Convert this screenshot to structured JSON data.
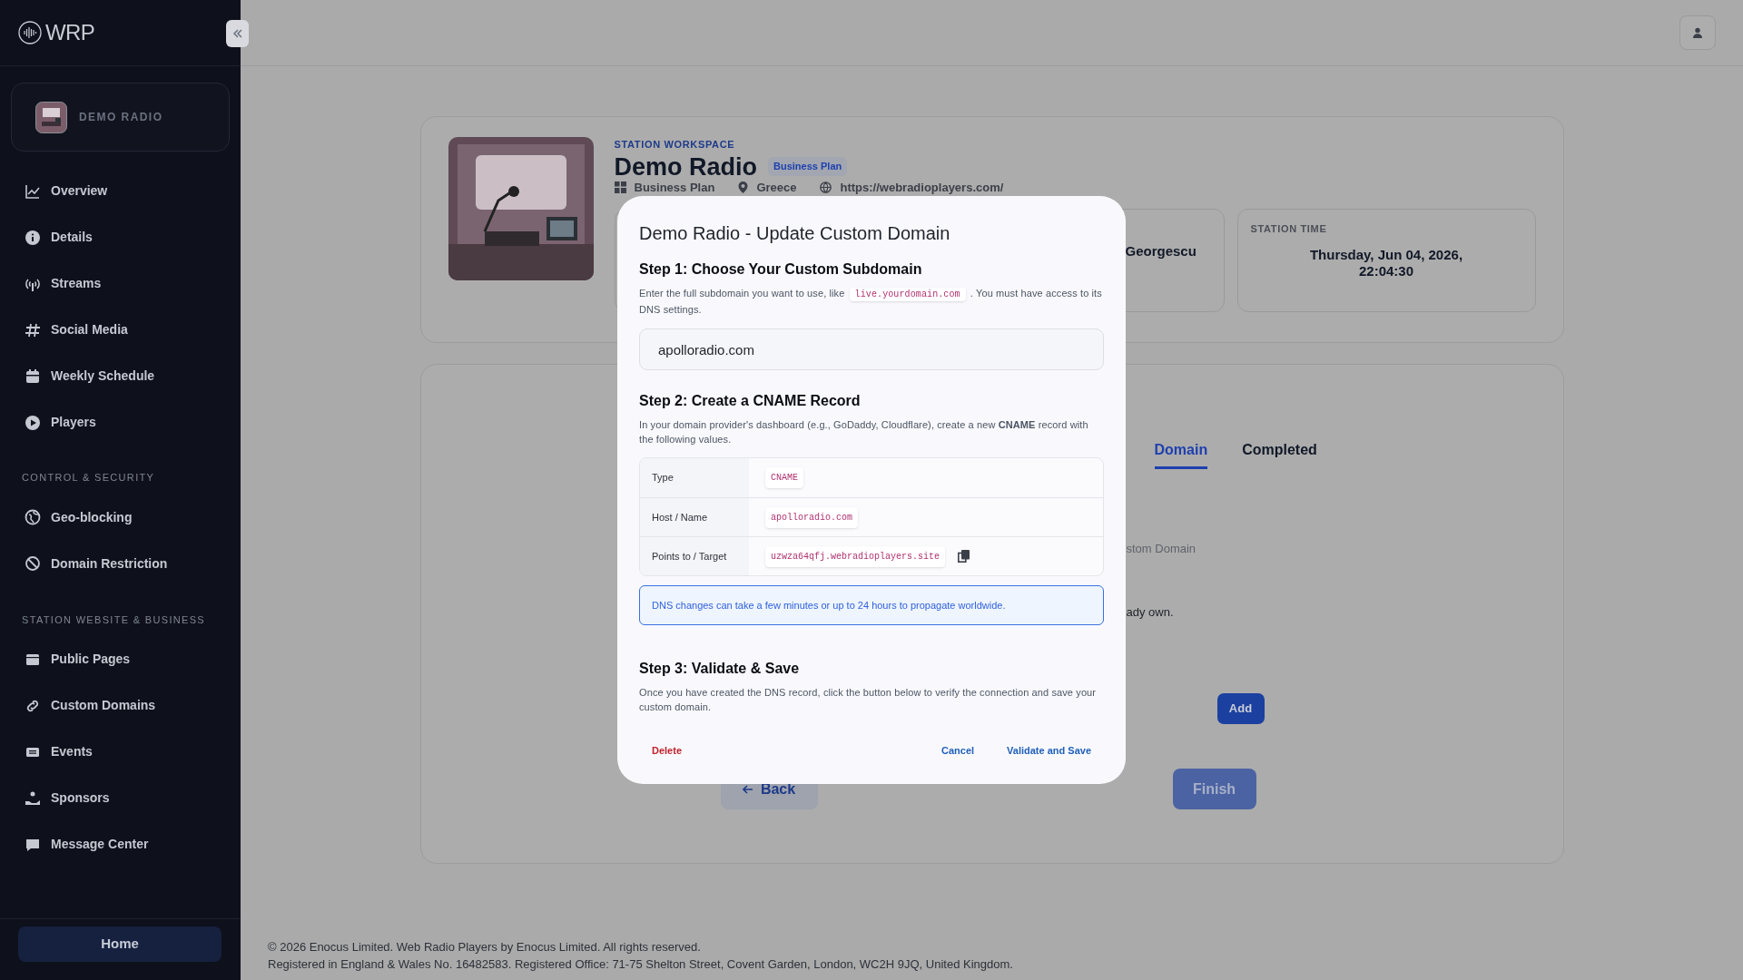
{
  "sidebar": {
    "logo": "WRP",
    "station": "DEMO RADIO",
    "sections": [
      {
        "items": [
          "Overview",
          "Details",
          "Streams",
          "Social Media",
          "Weekly Schedule",
          "Players"
        ]
      },
      {
        "heading": "CONTROL & SECURITY",
        "items": [
          "Geo-blocking",
          "Domain Restriction"
        ]
      },
      {
        "heading": "STATION WEBSITE & BUSINESS",
        "items": [
          "Public Pages",
          "Custom Domains",
          "Events",
          "Sponsors",
          "Message Center"
        ]
      }
    ],
    "home_button": "Home"
  },
  "station": {
    "eyebrow": "STATION WORKSPACE",
    "name": "Demo Radio",
    "badge": "Business Plan",
    "meta": [
      "Business Plan",
      "Greece",
      "https://webradioplayers.com/"
    ],
    "info_cards": [
      {
        "value": "Georgescu"
      },
      {
        "label": "STATION TIME",
        "value": "Thursday, Jun 04, 2026, 22:04:30"
      }
    ]
  },
  "wizard": {
    "tabs": [
      {
        "label": "Domain",
        "selected": true
      },
      {
        "label": "Completed",
        "selected": false
      }
    ],
    "fragment_1": "stom Domain",
    "fragment_2": "ady own.",
    "add_button": "Add",
    "back_button": "Back",
    "finish_button": "Finish"
  },
  "modal": {
    "title": "Demo Radio - Update Custom Domain",
    "step_1": {
      "heading": "Step 1: Choose Your Custom Subdomain",
      "text_before": "Enter the full subdomain you want to use, like",
      "code": "live.yourdomain.com",
      "text_after": ". You must have access to its DNS settings.",
      "input_value": "apolloradio.com"
    },
    "step_2": {
      "heading": "Step 2: Create a CNAME Record",
      "text": "In your domain provider's dashboard (e.g., GoDaddy, Cloudflare), create a new **CNAME** record with the following values.",
      "rows": [
        {
          "label": "Type",
          "value": "CNAME",
          "copy": false
        },
        {
          "label": "Host / Name",
          "value": "apolloradio.com",
          "copy": false
        },
        {
          "label": "Points to / Target",
          "value": "uzwza64qfj.webradioplayers.site",
          "copy": true
        }
      ],
      "notice": "DNS changes can take a few minutes or up to 24 hours to propagate worldwide."
    },
    "step_3": {
      "heading": "Step 3: Validate & Save",
      "text": "Once you have created the DNS record, click the button below to verify the connection and save your custom domain."
    },
    "buttons": {
      "delete": "Delete",
      "cancel": "Cancel",
      "validate": "Validate and Save"
    }
  },
  "footer": [
    "© 2026 Enocus Limited. Web Radio Players by Enocus Limited. All rights reserved.",
    "Registered in England & Wales No. 16482583. Registered Office: 71-75 Shelton Street, Covent Garden, London, WC2H 9JQ, United Kingdom."
  ]
}
